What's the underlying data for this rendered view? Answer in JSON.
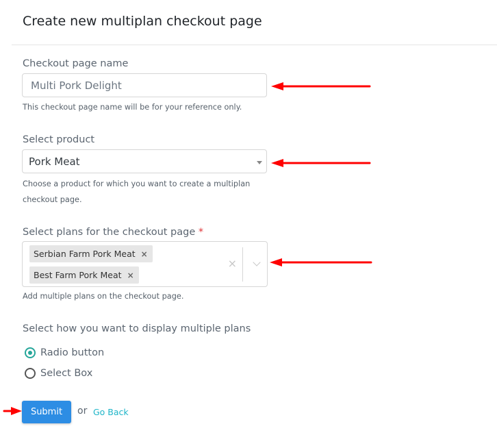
{
  "header": {
    "title": "Create new multiplan checkout page"
  },
  "checkout_name": {
    "label": "Checkout page name",
    "value": "Multi Pork Delight",
    "help": "This checkout page name will be for your reference only."
  },
  "product": {
    "label": "Select product",
    "selected": "Pork Meat",
    "help_line1": "Choose a product for which you want to create a multiplan",
    "help_line2": "checkout page."
  },
  "plans": {
    "label": "Select plans for the checkout page",
    "required_mark": "*",
    "tags": [
      {
        "label": "Serbian Farm Pork Meat",
        "remove": "×"
      },
      {
        "label": "Best Farm Pork Meat",
        "remove": "×"
      }
    ],
    "clear_icon": "×",
    "help": "Add multiple plans on the checkout page."
  },
  "display": {
    "label": "Select how you want to display multiple plans",
    "options": [
      {
        "label": "Radio button",
        "selected": true
      },
      {
        "label": "Select Box",
        "selected": false
      }
    ]
  },
  "actions": {
    "submit_label": "Submit",
    "or_text": "or",
    "go_back_label": "Go Back"
  },
  "colors": {
    "accent_teal": "#26a69a",
    "submit_blue": "#2d8de4",
    "link": "#1fb5c8",
    "annotation_arrow": "#ff0000"
  }
}
